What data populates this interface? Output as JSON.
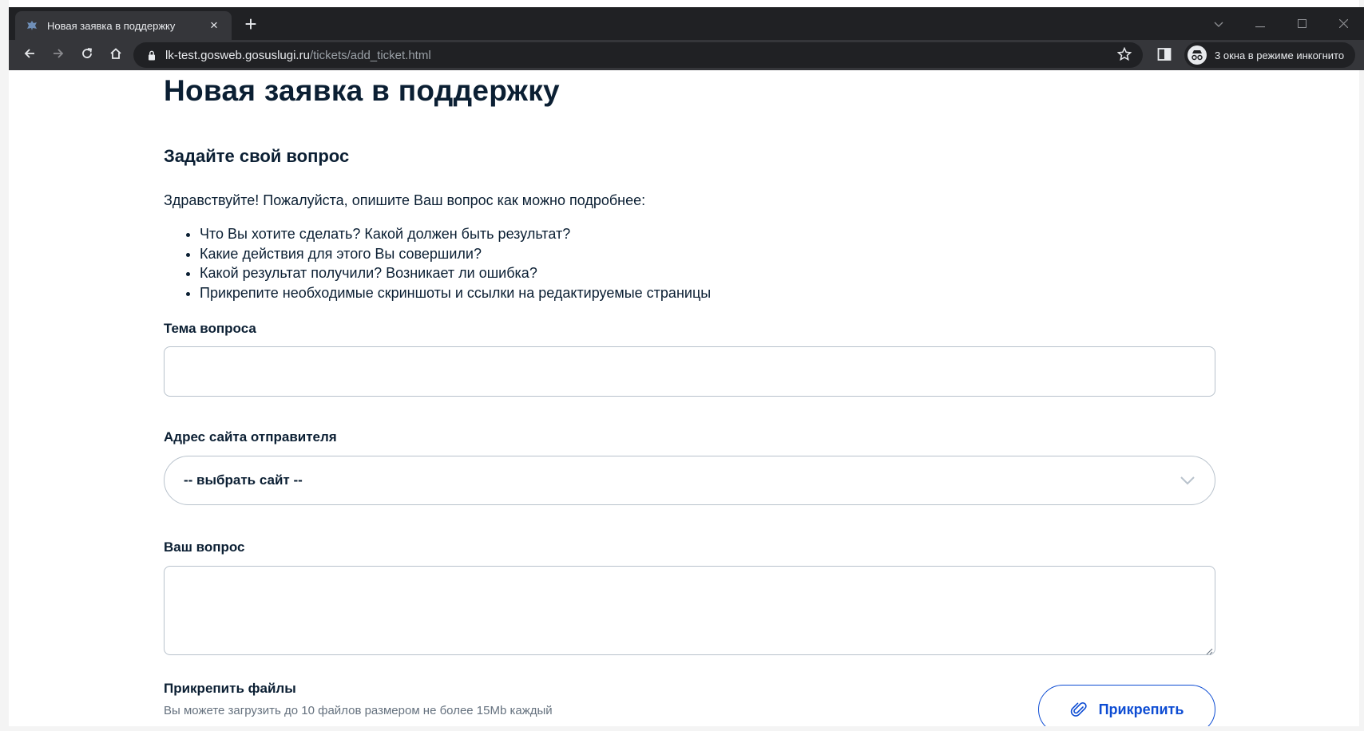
{
  "browser": {
    "tab_title": "Новая заявка в поддержку",
    "tab_close": "×",
    "new_tab": "+",
    "url_host": "lk-test.gosweb.gosuslugi.ru",
    "url_path": "/tickets/add_ticket.html",
    "incognito_label": "3 окна в режиме инкогнито"
  },
  "page": {
    "title": "Новая заявка в поддержку",
    "section_title": "Задайте свой вопрос",
    "intro": "Здравствуйте! Пожалуйста, опишите Ваш вопрос как можно подробнее:",
    "bullets": [
      "Что Вы хотите сделать? Какой должен быть результат?",
      "Какие действия для этого Вы совершили?",
      "Какой результат получили? Возникает ли ошибка?",
      "Прикрепите необходимые скриншоты и ссылки на редактируемые страницы"
    ]
  },
  "form": {
    "topic_label": "Тема вопроса",
    "topic_value": "",
    "site_label": "Адрес сайта отправителя",
    "site_selected": "-- выбрать сайт --",
    "question_label": "Ваш вопрос",
    "question_value": "",
    "files_label": "Прикрепить файлы",
    "files_hint": "Вы можете загрузить до 10 файлов размером не более 15Mb каждый",
    "attach_button": "Прикрепить"
  },
  "colors": {
    "text_primary": "#0b1f33",
    "accent": "#0d4cd3",
    "chrome_dark": "#202124",
    "chrome_toolbar": "#35363a"
  },
  "icons": {
    "favicon": "gerb-icon",
    "back": "arrow-left-icon",
    "forward": "arrow-right-icon",
    "reload": "reload-icon",
    "home": "home-icon",
    "lock": "lock-icon",
    "bookmark": "star-icon",
    "side_panel": "side-panel-icon",
    "incognito": "incognito-icon",
    "dropdown": "chevron-down-icon",
    "attach": "paperclip-icon"
  }
}
